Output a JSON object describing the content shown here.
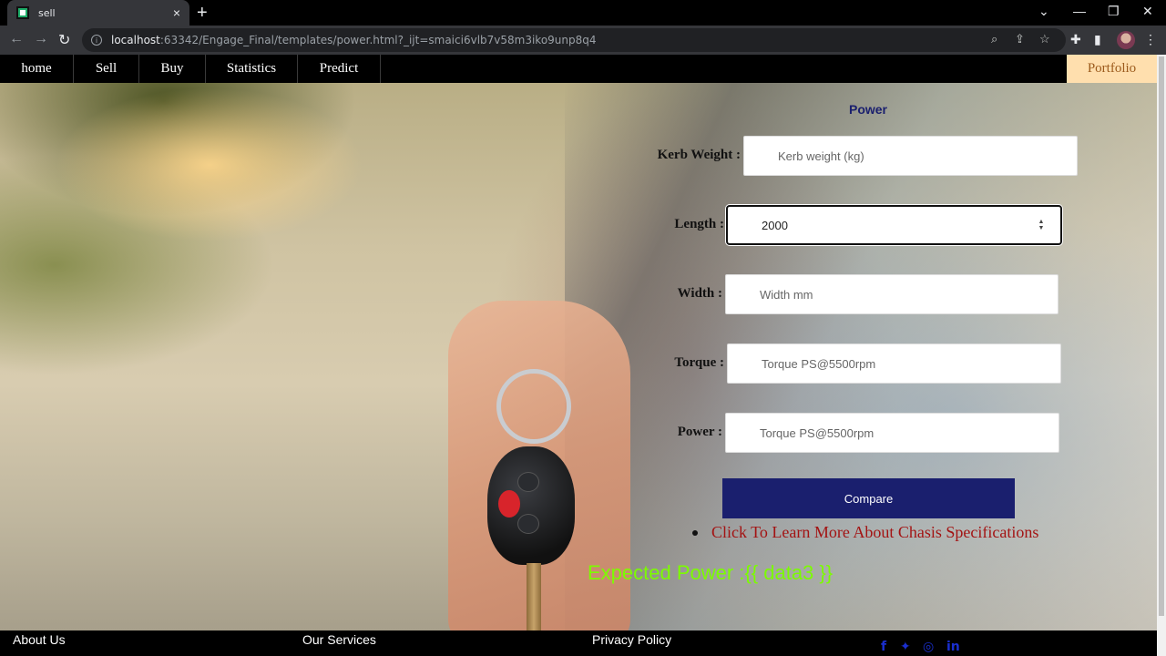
{
  "browser": {
    "tab_title": "sell",
    "tab_close": "×",
    "new_tab": "+",
    "url_host": "localhost",
    "url_rest": ":63342/Engage_Final/templates/power.html?_ijt=smaici6vlb7v58m3iko9unp8q4",
    "icons": [
      "back-icon",
      "forward-icon",
      "reload-icon",
      "info-icon",
      "zoom-icon",
      "share-icon",
      "bookmark-star-icon",
      "extensions-icon",
      "sidebar-icon",
      "profile-avatar",
      "menu-icon"
    ]
  },
  "nav": {
    "items": [
      {
        "label": "home"
      },
      {
        "label": "Sell"
      },
      {
        "label": "Buy"
      },
      {
        "label": "Statistics"
      },
      {
        "label": "Predict"
      }
    ],
    "portfolio": "Portfolio"
  },
  "form": {
    "title": "Power",
    "fields": [
      {
        "label": "Kerb Weight :",
        "placeholder": "Kerb weight (kg)",
        "value": ""
      },
      {
        "label": "Length :",
        "placeholder": "",
        "value": "2000"
      },
      {
        "label": "Width :",
        "placeholder": "Width mm",
        "value": ""
      },
      {
        "label": "Torque :",
        "placeholder": "Torque PS@5500rpm",
        "value": ""
      },
      {
        "label": "Power :",
        "placeholder": "Torque PS@5500rpm",
        "value": ""
      }
    ],
    "compare_label": "Compare",
    "learn_more": "Click To Learn More About Chasis Specifications",
    "result": "Expected Power :{{ data3 }}"
  },
  "footer": {
    "links": [
      "About Us",
      "Our Services",
      "Privacy Policy"
    ],
    "social": [
      "facebook-icon",
      "twitter-icon",
      "instagram-icon",
      "linkedin-icon"
    ]
  },
  "colors": {
    "nav_bg": "#000000",
    "portfolio_bg": "#ffdfae",
    "title": "#1a1f6e",
    "button": "#1a1f6e",
    "link": "#a31313",
    "result": "#7cfc00",
    "social": "#1a2fd0"
  }
}
